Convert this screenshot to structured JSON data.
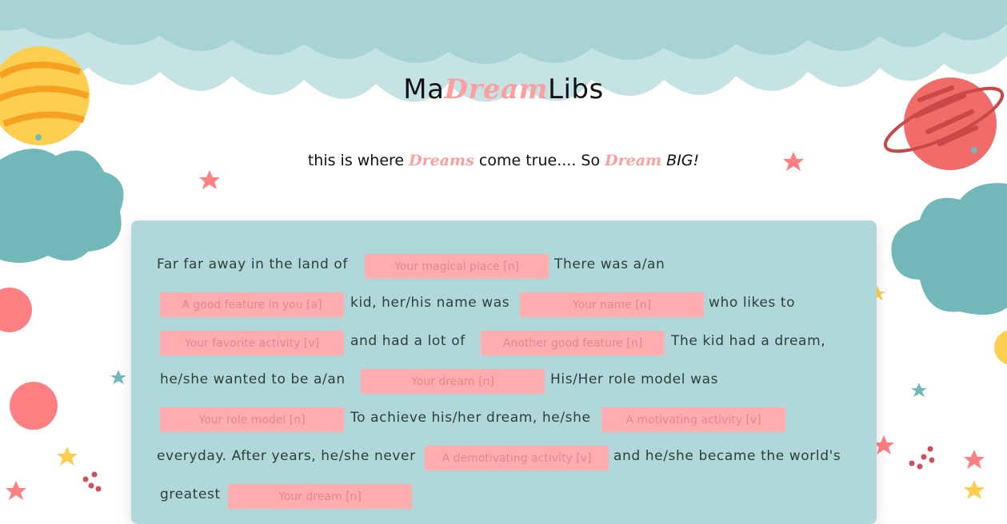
{
  "header": {
    "title_prefix": "Ma",
    "title_dream": "Dream",
    "title_suffix": "Libs",
    "tagline_part1": "this is where ",
    "tagline_dreams": "Dreams",
    "tagline_part2": " come true.... So ",
    "tagline_dream": "Dream",
    "tagline_big": "BIG!"
  },
  "story": {
    "t1": "Far far away in the land of",
    "t2": "There was a/an",
    "t3": "kid, her/his name was",
    "t4": "who likes to",
    "t5": "and had a lot of",
    "t6": "The kid had a dream,",
    "t7": "he/she wanted to be a/an",
    "t8": "His/Her role model was",
    "t9": "To achieve his/her dream, he/she",
    "t10": "everyday. After years, he/she never",
    "t11": "and he/she became the world's",
    "t12": "greatest"
  },
  "blanks": {
    "magical_place": "Your magical place [n]",
    "good_feature": "A good feature in you [a]",
    "name": "Your name [n]",
    "favorite_activity": "Your favorite activity [v]",
    "another_feature": "Another good feature [n]",
    "dream": "Your dream [n]",
    "role_model": "Your role model [n]",
    "motivating": "A motivating activity [v]",
    "demotivating": "A demotivating activity [v]",
    "dream2": "Your dream [n]"
  },
  "colors": {
    "accent_pink": "#ff9e9e",
    "card_bg": "#b0d8d9",
    "cloud_light": "#a7d3d5",
    "cloud_teal": "#72b8b9",
    "planet_yellow": "#ffce4f",
    "planet_red": "#f26b6b"
  }
}
